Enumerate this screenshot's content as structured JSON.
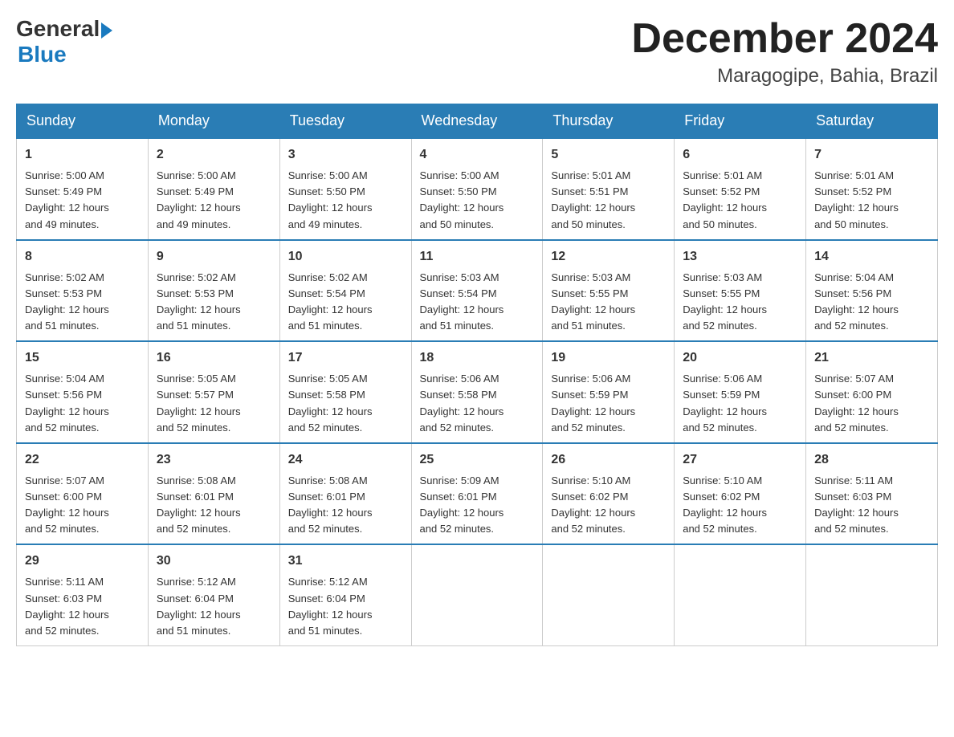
{
  "header": {
    "logo_general": "General",
    "logo_blue": "Blue",
    "month_title": "December 2024",
    "location": "Maragogipe, Bahia, Brazil"
  },
  "weekdays": [
    "Sunday",
    "Monday",
    "Tuesday",
    "Wednesday",
    "Thursday",
    "Friday",
    "Saturday"
  ],
  "weeks": [
    [
      {
        "day": "1",
        "sunrise": "5:00 AM",
        "sunset": "5:49 PM",
        "daylight": "12 hours and 49 minutes."
      },
      {
        "day": "2",
        "sunrise": "5:00 AM",
        "sunset": "5:49 PM",
        "daylight": "12 hours and 49 minutes."
      },
      {
        "day": "3",
        "sunrise": "5:00 AM",
        "sunset": "5:50 PM",
        "daylight": "12 hours and 49 minutes."
      },
      {
        "day": "4",
        "sunrise": "5:00 AM",
        "sunset": "5:50 PM",
        "daylight": "12 hours and 50 minutes."
      },
      {
        "day": "5",
        "sunrise": "5:01 AM",
        "sunset": "5:51 PM",
        "daylight": "12 hours and 50 minutes."
      },
      {
        "day": "6",
        "sunrise": "5:01 AM",
        "sunset": "5:52 PM",
        "daylight": "12 hours and 50 minutes."
      },
      {
        "day": "7",
        "sunrise": "5:01 AM",
        "sunset": "5:52 PM",
        "daylight": "12 hours and 50 minutes."
      }
    ],
    [
      {
        "day": "8",
        "sunrise": "5:02 AM",
        "sunset": "5:53 PM",
        "daylight": "12 hours and 51 minutes."
      },
      {
        "day": "9",
        "sunrise": "5:02 AM",
        "sunset": "5:53 PM",
        "daylight": "12 hours and 51 minutes."
      },
      {
        "day": "10",
        "sunrise": "5:02 AM",
        "sunset": "5:54 PM",
        "daylight": "12 hours and 51 minutes."
      },
      {
        "day": "11",
        "sunrise": "5:03 AM",
        "sunset": "5:54 PM",
        "daylight": "12 hours and 51 minutes."
      },
      {
        "day": "12",
        "sunrise": "5:03 AM",
        "sunset": "5:55 PM",
        "daylight": "12 hours and 51 minutes."
      },
      {
        "day": "13",
        "sunrise": "5:03 AM",
        "sunset": "5:55 PM",
        "daylight": "12 hours and 52 minutes."
      },
      {
        "day": "14",
        "sunrise": "5:04 AM",
        "sunset": "5:56 PM",
        "daylight": "12 hours and 52 minutes."
      }
    ],
    [
      {
        "day": "15",
        "sunrise": "5:04 AM",
        "sunset": "5:56 PM",
        "daylight": "12 hours and 52 minutes."
      },
      {
        "day": "16",
        "sunrise": "5:05 AM",
        "sunset": "5:57 PM",
        "daylight": "12 hours and 52 minutes."
      },
      {
        "day": "17",
        "sunrise": "5:05 AM",
        "sunset": "5:58 PM",
        "daylight": "12 hours and 52 minutes."
      },
      {
        "day": "18",
        "sunrise": "5:06 AM",
        "sunset": "5:58 PM",
        "daylight": "12 hours and 52 minutes."
      },
      {
        "day": "19",
        "sunrise": "5:06 AM",
        "sunset": "5:59 PM",
        "daylight": "12 hours and 52 minutes."
      },
      {
        "day": "20",
        "sunrise": "5:06 AM",
        "sunset": "5:59 PM",
        "daylight": "12 hours and 52 minutes."
      },
      {
        "day": "21",
        "sunrise": "5:07 AM",
        "sunset": "6:00 PM",
        "daylight": "12 hours and 52 minutes."
      }
    ],
    [
      {
        "day": "22",
        "sunrise": "5:07 AM",
        "sunset": "6:00 PM",
        "daylight": "12 hours and 52 minutes."
      },
      {
        "day": "23",
        "sunrise": "5:08 AM",
        "sunset": "6:01 PM",
        "daylight": "12 hours and 52 minutes."
      },
      {
        "day": "24",
        "sunrise": "5:08 AM",
        "sunset": "6:01 PM",
        "daylight": "12 hours and 52 minutes."
      },
      {
        "day": "25",
        "sunrise": "5:09 AM",
        "sunset": "6:01 PM",
        "daylight": "12 hours and 52 minutes."
      },
      {
        "day": "26",
        "sunrise": "5:10 AM",
        "sunset": "6:02 PM",
        "daylight": "12 hours and 52 minutes."
      },
      {
        "day": "27",
        "sunrise": "5:10 AM",
        "sunset": "6:02 PM",
        "daylight": "12 hours and 52 minutes."
      },
      {
        "day": "28",
        "sunrise": "5:11 AM",
        "sunset": "6:03 PM",
        "daylight": "12 hours and 52 minutes."
      }
    ],
    [
      {
        "day": "29",
        "sunrise": "5:11 AM",
        "sunset": "6:03 PM",
        "daylight": "12 hours and 52 minutes."
      },
      {
        "day": "30",
        "sunrise": "5:12 AM",
        "sunset": "6:04 PM",
        "daylight": "12 hours and 51 minutes."
      },
      {
        "day": "31",
        "sunrise": "5:12 AM",
        "sunset": "6:04 PM",
        "daylight": "12 hours and 51 minutes."
      },
      null,
      null,
      null,
      null
    ]
  ],
  "labels": {
    "sunrise": "Sunrise:",
    "sunset": "Sunset:",
    "daylight": "Daylight:"
  }
}
